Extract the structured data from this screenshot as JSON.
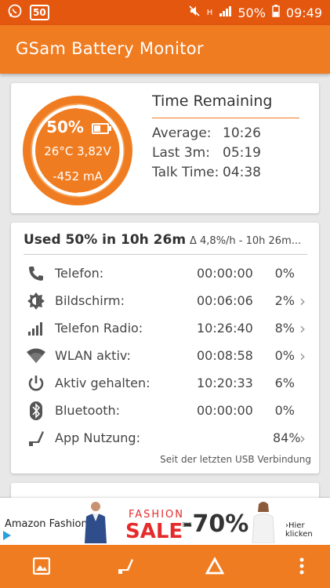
{
  "status_bar": {
    "badge": "50",
    "net_label": "H",
    "battery": "50%",
    "time": "09:49"
  },
  "app_bar": {
    "title": "GSam Battery Monitor"
  },
  "gauge": {
    "percent": "50%",
    "temp_voltage": "26°C 3,82V",
    "current": "-452 mA",
    "level": 0.5,
    "color": "#f07c21"
  },
  "time_remaining": {
    "title": "Time Remaining",
    "rows": [
      {
        "label": "Average:",
        "value": "10:26"
      },
      {
        "label": "Last 3m:",
        "value": "05:19"
      },
      {
        "label": "Talk Time:",
        "value": "04:38"
      }
    ]
  },
  "usage": {
    "title": "Used 50% in 10h 26m",
    "rate": "Δ 4,8%/h - 10h 26m...",
    "rows": [
      {
        "icon": "phone-icon",
        "name": "Telefon:",
        "time": "00:00:00",
        "pct": "0%",
        "chevron": false
      },
      {
        "icon": "brightness-icon",
        "name": "Bildschirm:",
        "time": "00:06:06",
        "pct": "2%",
        "chevron": true
      },
      {
        "icon": "signal-icon",
        "name": "Telefon Radio:",
        "time": "10:26:40",
        "pct": "8%",
        "chevron": true
      },
      {
        "icon": "wifi-icon",
        "name": "WLAN aktiv:",
        "time": "00:08:58",
        "pct": "0%",
        "chevron": true
      },
      {
        "icon": "power-icon",
        "name": "Aktiv gehalten:",
        "time": "10:20:33",
        "pct": "6%",
        "chevron": false
      },
      {
        "icon": "bluetooth-icon",
        "name": "Bluetooth:",
        "time": "00:00:00",
        "pct": "0%",
        "chevron": false
      },
      {
        "icon": "app-usage-icon",
        "name": "App Nutzung:",
        "time": "",
        "pct": "84%",
        "chevron": true
      }
    ],
    "note": "Seit der letzten USB Verbindung"
  },
  "ad": {
    "brand": "Amazon Fashion",
    "fashion": "FASHION",
    "sale": "SALE",
    "bis": "BIS",
    "discount": "-70%",
    "cta": "›Hier klicken"
  },
  "nav": {
    "items": [
      "image-icon",
      "app-usage-icon",
      "delta-icon",
      "more-icon"
    ]
  }
}
